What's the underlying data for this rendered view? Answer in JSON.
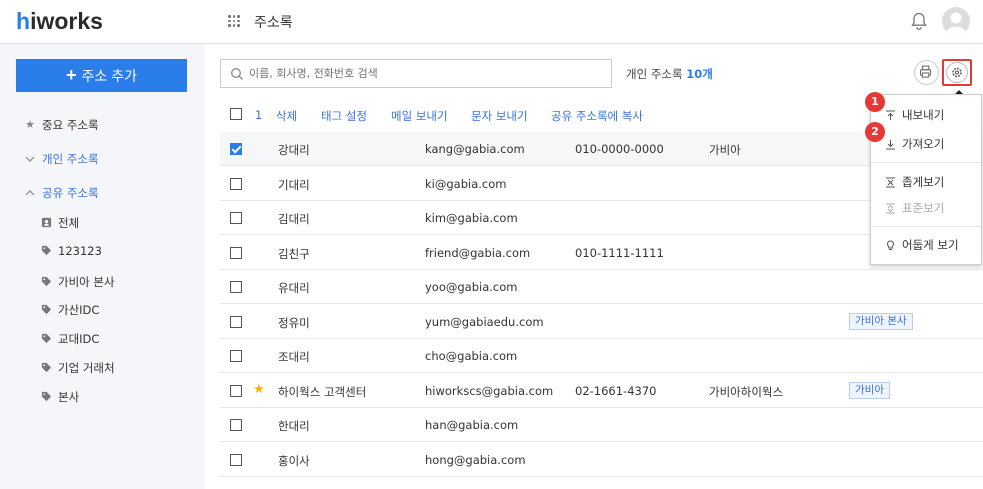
{
  "header": {
    "logo_h": "h",
    "logo_rest": "iworks",
    "app_title": "주소록"
  },
  "sidebar": {
    "add_button": "주소 추가",
    "items": [
      {
        "label": "중요 주소록"
      },
      {
        "label": "개인 주소록"
      },
      {
        "label": "공유 주소록"
      }
    ],
    "shared_groups": [
      {
        "label": "전체"
      },
      {
        "label": "123123"
      },
      {
        "label": "가비아 본사"
      },
      {
        "label": "가산IDC"
      },
      {
        "label": "교대IDC"
      },
      {
        "label": "기업 거래처"
      },
      {
        "label": "본사"
      }
    ]
  },
  "search": {
    "placeholder": "이름, 회사명, 전화번호 검색"
  },
  "summary": {
    "label": "개인 주소록 ",
    "count": "10개"
  },
  "settings_tooltip": "설정",
  "toolbar": {
    "selected_count": "1",
    "actions": [
      "삭제",
      "태그 설정",
      "메일 보내기",
      "문자 보내기",
      "공유 주소록에 복사"
    ]
  },
  "contacts": [
    {
      "name": "강대리",
      "email": "kang@gabia.com",
      "phone": "010-0000-0000",
      "company": "가비아",
      "tag": "",
      "checked": true,
      "starred": false
    },
    {
      "name": "기대리",
      "email": "ki@gabia.com",
      "phone": "",
      "company": "",
      "tag": "",
      "checked": false,
      "starred": false
    },
    {
      "name": "김대리",
      "email": "kim@gabia.com",
      "phone": "",
      "company": "",
      "tag": "",
      "checked": false,
      "starred": false
    },
    {
      "name": "김친구",
      "email": "friend@gabia.com",
      "phone": "010-1111-1111",
      "company": "",
      "tag": "",
      "checked": false,
      "starred": false
    },
    {
      "name": "유대리",
      "email": "yoo@gabia.com",
      "phone": "",
      "company": "",
      "tag": "",
      "checked": false,
      "starred": false
    },
    {
      "name": "정유미",
      "email": "yum@gabiaedu.com",
      "phone": "",
      "company": "",
      "tag": "가비아 본사",
      "checked": false,
      "starred": false
    },
    {
      "name": "조대리",
      "email": "cho@gabia.com",
      "phone": "",
      "company": "",
      "tag": "",
      "checked": false,
      "starred": false
    },
    {
      "name": "하이웍스 고객센터",
      "email": "hiworkscs@gabia.com",
      "phone": "02-1661-4370",
      "company": "가비아하이웍스",
      "tag": "가비아",
      "checked": false,
      "starred": true
    },
    {
      "name": "한대리",
      "email": "han@gabia.com",
      "phone": "",
      "company": "",
      "tag": "",
      "checked": false,
      "starred": false
    },
    {
      "name": "홍이사",
      "email": "hong@gabia.com",
      "phone": "",
      "company": "",
      "tag": "",
      "checked": false,
      "starred": false
    }
  ],
  "settings_menu": {
    "export": "내보내기",
    "import": "가져오기",
    "compact_view": "좁게보기",
    "standard_view": "표준보기",
    "dark_view": "어둡게 보기"
  },
  "callouts": [
    "1",
    "2"
  ],
  "colors": {
    "accent": "#2b7de9",
    "callout": "#e53935",
    "star": "#f4b400"
  }
}
